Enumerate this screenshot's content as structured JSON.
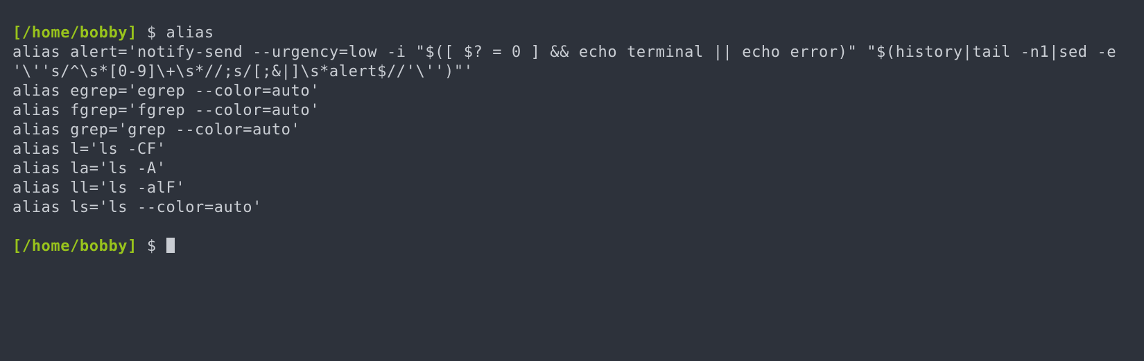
{
  "prompt1": {
    "path": "[/home/bobby]",
    "symbol": " $ ",
    "command": "alias"
  },
  "output": {
    "l1": "alias alert='notify-send --urgency=low -i \"$([ $? = 0 ] && echo terminal || echo error)\" \"$(history|tail -n1|sed -e '\\''s/^\\s*[0-9]\\+\\s*//;s/[;&|]\\s*alert$//'\\'')\"'",
    "l2": "alias egrep='egrep --color=auto'",
    "l3": "alias fgrep='fgrep --color=auto'",
    "l4": "alias grep='grep --color=auto'",
    "l5": "alias l='ls -CF'",
    "l6": "alias la='ls -A'",
    "l7": "alias ll='ls -alF'",
    "l8": "alias ls='ls --color=auto'"
  },
  "prompt2": {
    "path": "[/home/bobby]",
    "symbol": " $ "
  }
}
